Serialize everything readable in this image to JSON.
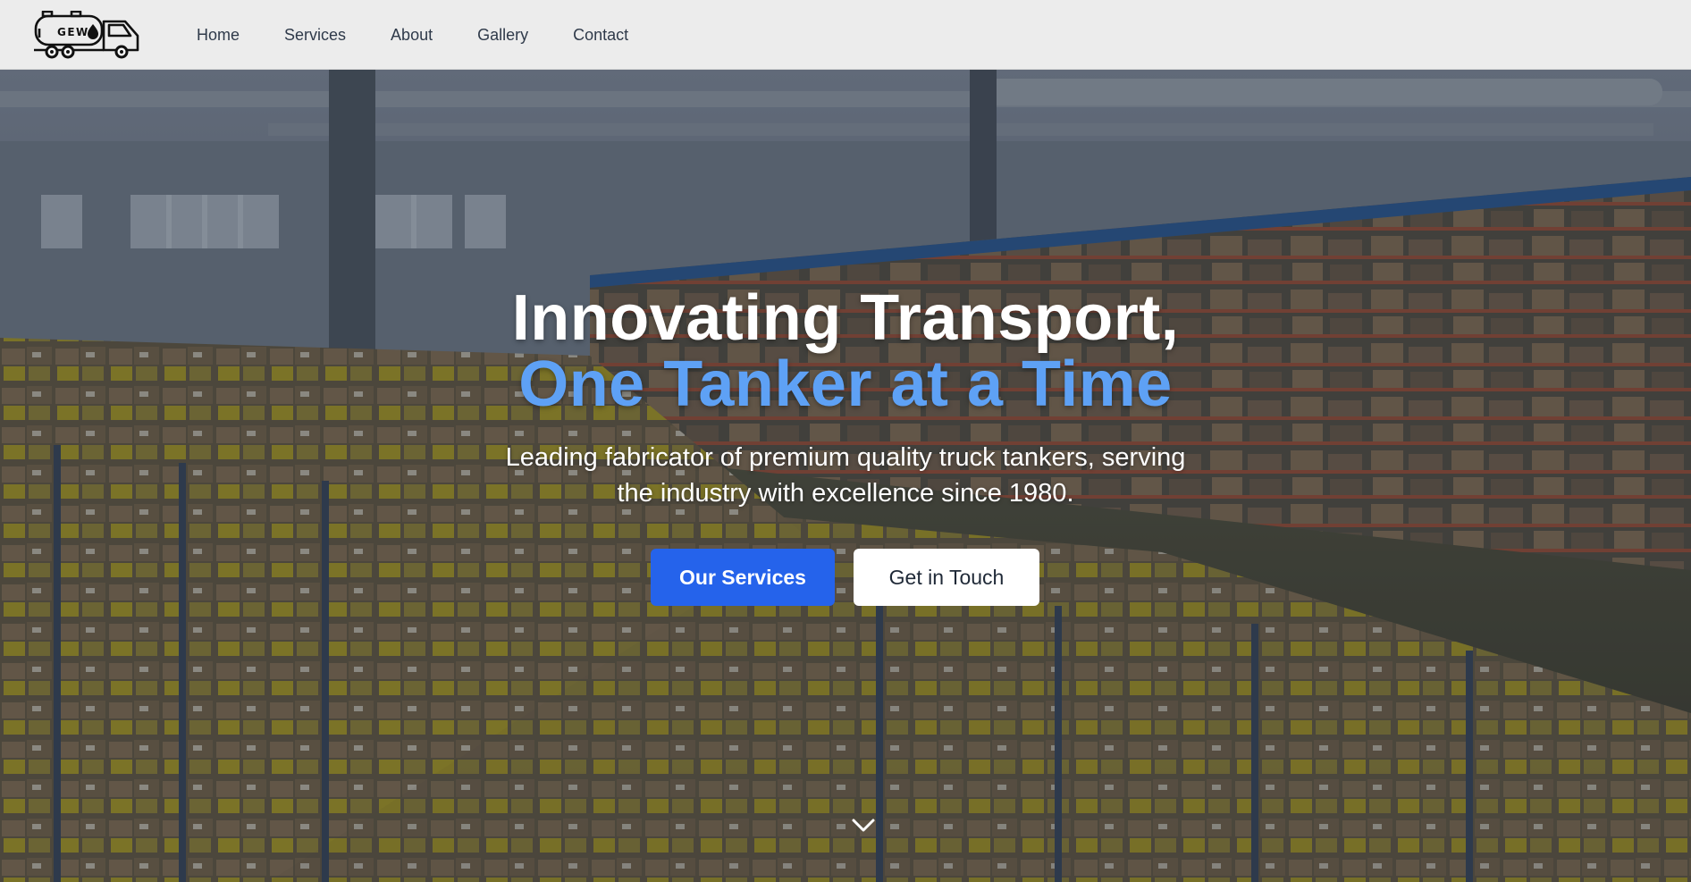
{
  "brand": {
    "logo_text": "GEW",
    "icon": "tanker-truck-icon"
  },
  "nav": {
    "items": [
      {
        "label": "Home"
      },
      {
        "label": "Services"
      },
      {
        "label": "About"
      },
      {
        "label": "Gallery"
      },
      {
        "label": "Contact"
      }
    ]
  },
  "hero": {
    "headline_line1": "Innovating Transport,",
    "headline_line2": "One Tanker at a Time",
    "subtext_line1": "Leading fabricator of premium quality truck tankers, serving",
    "subtext_line2": "the industry with excellence since 1980.",
    "primary_button": "Our Services",
    "secondary_button": "Get in Touch",
    "scroll_icon": "chevron-down-icon",
    "background": "warehouse-photo"
  },
  "colors": {
    "accent": "#5ea1f5",
    "primary_button": "#2563eb",
    "navbar_bg": "#ececec"
  }
}
